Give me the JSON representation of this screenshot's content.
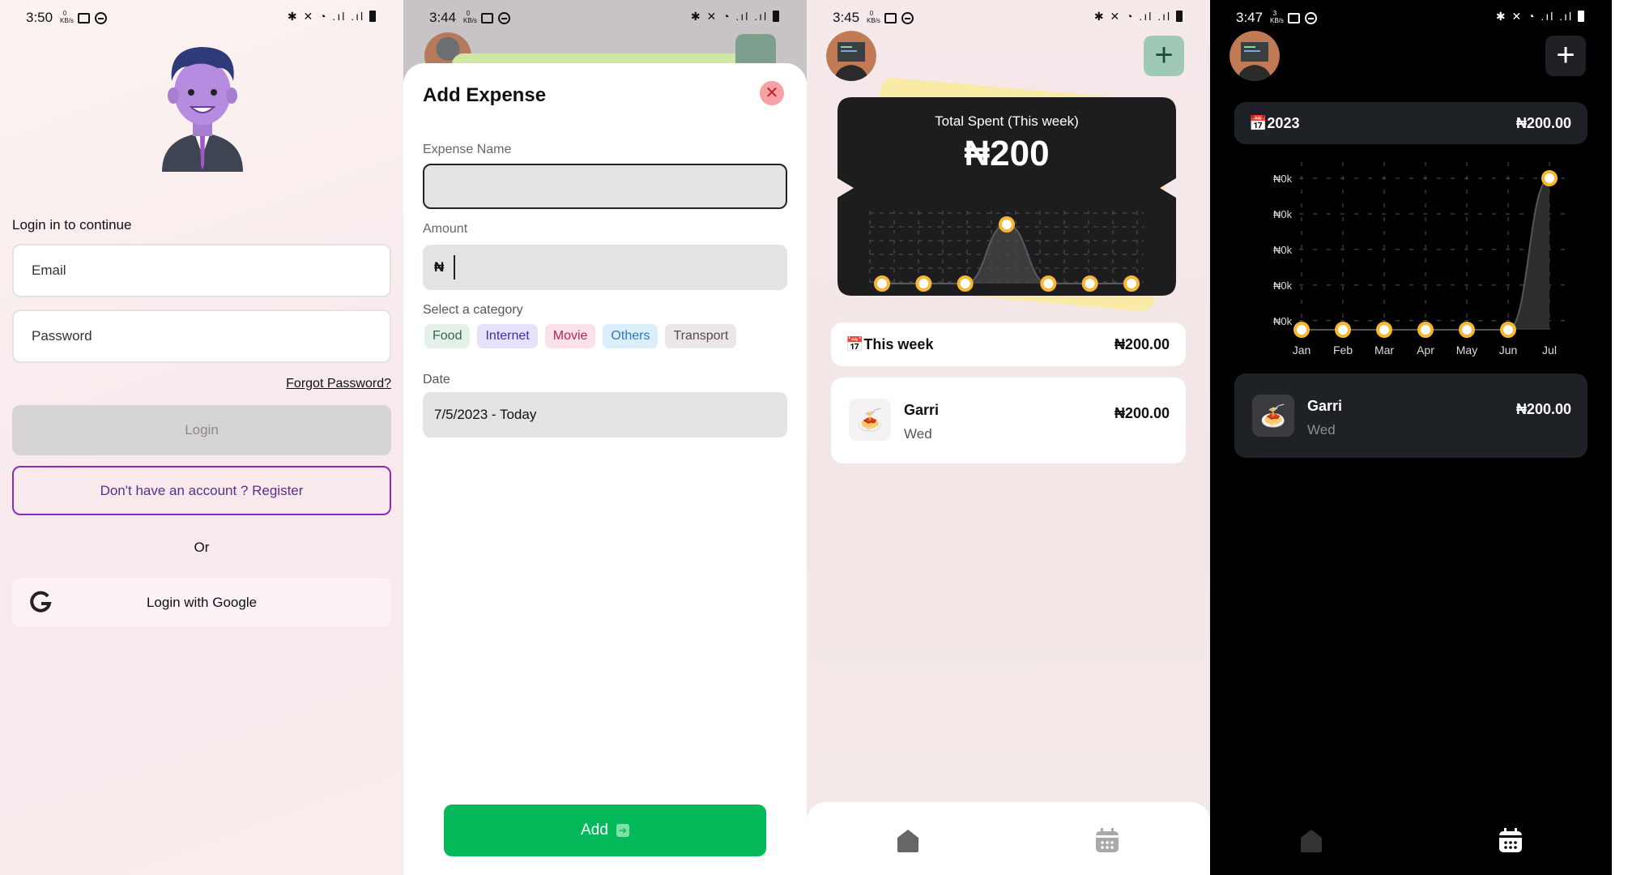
{
  "login_screen": {
    "status": {
      "time": "3:50",
      "kbs_top": "0",
      "kbs_unit": "KB/s"
    },
    "title": "Login in to continue",
    "email_placeholder": "Email",
    "password_placeholder": "Password",
    "forgot": "Forgot Password?",
    "login_label": "Login",
    "register_label": "Don't have an account ? Register",
    "or": "Or",
    "google_label": "Login with Google"
  },
  "add_expense_screen": {
    "status": {
      "time": "3:44",
      "kbs_top": "0",
      "kbs_unit": "KB/s"
    },
    "title": "Add Expense",
    "close_glyph": "✕",
    "name_label": "Expense Name",
    "amount_label": "Amount",
    "currency_symbol": "₦",
    "category_label": "Select a category",
    "categories": [
      {
        "label": "Food",
        "bg": "#e6f0ea",
        "fg": "#2f6a49"
      },
      {
        "label": "Internet",
        "bg": "#e6e2fb",
        "fg": "#3a2fb0"
      },
      {
        "label": "Movie",
        "bg": "#fbe1e8",
        "fg": "#b02a54"
      },
      {
        "label": "Others",
        "bg": "#ddeefb",
        "fg": "#2a79c4"
      },
      {
        "label": "Transport",
        "bg": "#ece7e7",
        "fg": "#5a4a4a"
      }
    ],
    "date_label": "Date",
    "date_value": "7/5/2023  - Today",
    "add_label": "Add"
  },
  "weekly_screen": {
    "status": {
      "time": "3:45",
      "kbs_top": "0",
      "kbs_unit": "KB/s"
    },
    "card_title": "Total Spent (This week)",
    "card_amount": "₦200",
    "week_label": "This week",
    "week_total": "₦200.00",
    "expense": {
      "name": "Garri",
      "day": "Wed",
      "amount": "₦200.00"
    },
    "accent": "#f7b733"
  },
  "yearly_screen": {
    "status": {
      "time": "3:47",
      "kbs_top": "3",
      "kbs_unit": "KB/s"
    },
    "year_label": "2023",
    "year_total": "₦200.00",
    "y_ticks": [
      "₦0k",
      "₦0k",
      "₦0k",
      "₦0k",
      "₦0k"
    ],
    "expense": {
      "name": "Garri",
      "day": "Wed",
      "amount": "₦200.00"
    }
  },
  "chart_data": [
    {
      "type": "area",
      "title": "Total Spent (This week)",
      "x": [
        "1",
        "2",
        "3",
        "4",
        "5",
        "6",
        "7"
      ],
      "series": [
        {
          "values": [
            0,
            0,
            0,
            200,
            0,
            0,
            0
          ]
        }
      ],
      "grid": true
    },
    {
      "type": "area",
      "categories": [
        "Jan",
        "Feb",
        "Mar",
        "Apr",
        "May",
        "Jun",
        "Jul"
      ],
      "series": [
        {
          "values": [
            0,
            0,
            0,
            0,
            0,
            0,
            200
          ]
        }
      ],
      "y_tick_labels": [
        "₦0k",
        "₦0k",
        "₦0k",
        "₦0k",
        "₦0k"
      ],
      "grid": true
    }
  ]
}
